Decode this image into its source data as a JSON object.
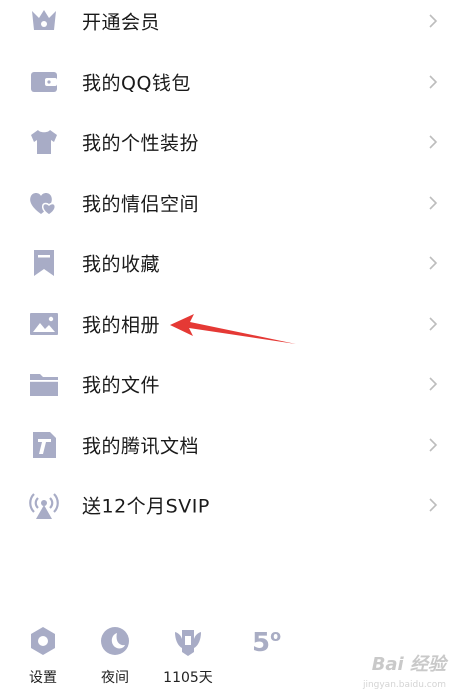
{
  "colors": {
    "icon": "#a8acc6",
    "chevron": "#bdbdbd",
    "arrow": "#e53935"
  },
  "menu": {
    "items": [
      {
        "label": "开通会员",
        "icon": "crown-icon"
      },
      {
        "label": "我的QQ钱包",
        "icon": "wallet-icon"
      },
      {
        "label": "我的个性装扮",
        "icon": "tshirt-icon"
      },
      {
        "label": "我的情侣空间",
        "icon": "hearts-icon"
      },
      {
        "label": "我的收藏",
        "icon": "bookmark-icon"
      },
      {
        "label": "我的相册",
        "icon": "photo-icon"
      },
      {
        "label": "我的文件",
        "icon": "folder-icon"
      },
      {
        "label": "我的腾讯文档",
        "icon": "document-icon"
      },
      {
        "label": "送12个月SVIP",
        "icon": "broadcast-icon"
      }
    ]
  },
  "bottom": {
    "settings_label": "设置",
    "night_label": "夜间",
    "days_label": "1105天",
    "temperature": "5",
    "degree": "o"
  },
  "watermark": {
    "text": "Bai 经验",
    "sub": "jingyan.baidu.com"
  }
}
